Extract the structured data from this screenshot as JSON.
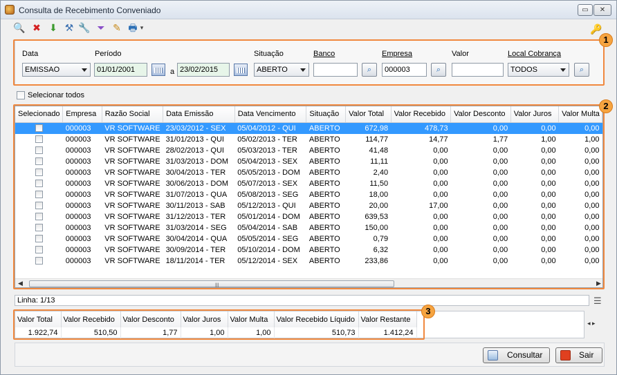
{
  "window": {
    "title": "Consulta de Recebimento Conveniado",
    "min_glyph": "▭",
    "close_glyph": "✕"
  },
  "toolbar": {
    "icons": [
      "search-icon",
      "delete-icon",
      "download-icon",
      "tools-icon",
      "wrench-icon",
      "filter-icon",
      "edit-icon",
      "print-icon"
    ],
    "glyphs": [
      "🔍",
      "✖",
      "⬇",
      "⚒",
      "🔧",
      "⏷",
      "✎",
      "🖶"
    ],
    "dropdown_glyph": "▾",
    "key_glyph": "🔑"
  },
  "filters": {
    "data_label": "Data",
    "data_value": "EMISSAO",
    "periodo_label": "Período",
    "periodo_start": "01/01/2001",
    "periodo_sep": "a",
    "periodo_end": "23/02/2015",
    "situacao_label": "Situação",
    "situacao_value": "ABERTO",
    "banco_label": "Banco",
    "banco_value": "",
    "empresa_label": "Empresa",
    "empresa_value": "000003",
    "valor_label": "Valor",
    "valor_value": "",
    "local_label": "Local Cobrança",
    "local_value": "TODOS"
  },
  "badges": [
    "1",
    "2",
    "3"
  ],
  "select_all_label": "Selecionar todos",
  "grid": {
    "columns": [
      "Selecionado",
      "Empresa",
      "Razão Social",
      "Data Emissão",
      "Data Vencimento",
      "Situação",
      "Valor Total",
      "Valor Recebido",
      "Valor Desconto",
      "Valor Juros",
      "Valor Multa"
    ],
    "rows": [
      [
        "000003",
        "VR SOFTWARE",
        "23/03/2012 - SEX",
        "05/04/2012 - QUI",
        "ABERTO",
        "672,98",
        "478,73",
        "0,00",
        "0,00",
        "0,00"
      ],
      [
        "000003",
        "VR SOFTWARE",
        "31/01/2013 - QUI",
        "05/02/2013 - TER",
        "ABERTO",
        "114,77",
        "14,77",
        "1,77",
        "1,00",
        "1,00"
      ],
      [
        "000003",
        "VR SOFTWARE",
        "28/02/2013 - QUI",
        "05/03/2013 - TER",
        "ABERTO",
        "41,48",
        "0,00",
        "0,00",
        "0,00",
        "0,00"
      ],
      [
        "000003",
        "VR SOFTWARE",
        "31/03/2013 - DOM",
        "05/04/2013 - SEX",
        "ABERTO",
        "11,11",
        "0,00",
        "0,00",
        "0,00",
        "0,00"
      ],
      [
        "000003",
        "VR SOFTWARE",
        "30/04/2013 - TER",
        "05/05/2013 - DOM",
        "ABERTO",
        "2,40",
        "0,00",
        "0,00",
        "0,00",
        "0,00"
      ],
      [
        "000003",
        "VR SOFTWARE",
        "30/06/2013 - DOM",
        "05/07/2013 - SEX",
        "ABERTO",
        "11,50",
        "0,00",
        "0,00",
        "0,00",
        "0,00"
      ],
      [
        "000003",
        "VR SOFTWARE",
        "31/07/2013 - QUA",
        "05/08/2013 - SEG",
        "ABERTO",
        "18,00",
        "0,00",
        "0,00",
        "0,00",
        "0,00"
      ],
      [
        "000003",
        "VR SOFTWARE",
        "30/11/2013 - SAB",
        "05/12/2013 - QUI",
        "ABERTO",
        "20,00",
        "17,00",
        "0,00",
        "0,00",
        "0,00"
      ],
      [
        "000003",
        "VR SOFTWARE",
        "31/12/2013 - TER",
        "05/01/2014 - DOM",
        "ABERTO",
        "639,53",
        "0,00",
        "0,00",
        "0,00",
        "0,00"
      ],
      [
        "000003",
        "VR SOFTWARE",
        "31/03/2014 - SEG",
        "05/04/2014 - SAB",
        "ABERTO",
        "150,00",
        "0,00",
        "0,00",
        "0,00",
        "0,00"
      ],
      [
        "000003",
        "VR SOFTWARE",
        "30/04/2014 - QUA",
        "05/05/2014 - SEG",
        "ABERTO",
        "0,79",
        "0,00",
        "0,00",
        "0,00",
        "0,00"
      ],
      [
        "000003",
        "VR SOFTWARE",
        "30/09/2014 - TER",
        "05/10/2014 - DOM",
        "ABERTO",
        "6,32",
        "0,00",
        "0,00",
        "0,00",
        "0,00"
      ],
      [
        "000003",
        "VR SOFTWARE",
        "18/11/2014 - TER",
        "05/12/2014 - SEX",
        "ABERTO",
        "233,86",
        "0,00",
        "0,00",
        "0,00",
        "0,00"
      ]
    ],
    "selected_row": 0,
    "scroll_left_glyph": "◀",
    "scroll_right_glyph": "▶",
    "scroll_grip_glyph": "|||"
  },
  "status": {
    "linha": "Linha: 1/13",
    "menu_glyph": "☰"
  },
  "totals": {
    "columns": [
      "Valor Total",
      "Valor Recebido",
      "Valor Desconto",
      "Valor Juros",
      "Valor Multa",
      "Valor Recebido Líquido",
      "Valor Restante"
    ],
    "values": [
      "1.922,74",
      "510,50",
      "1,77",
      "1,00",
      "1,00",
      "510,73",
      "1.412,24"
    ],
    "nav_glyph": "◂ ▸"
  },
  "buttons": {
    "consultar": "Consultar",
    "sair": "Sair"
  },
  "colors": {
    "accent_orange": "#f0883e",
    "selection_blue": "#3399ff"
  }
}
